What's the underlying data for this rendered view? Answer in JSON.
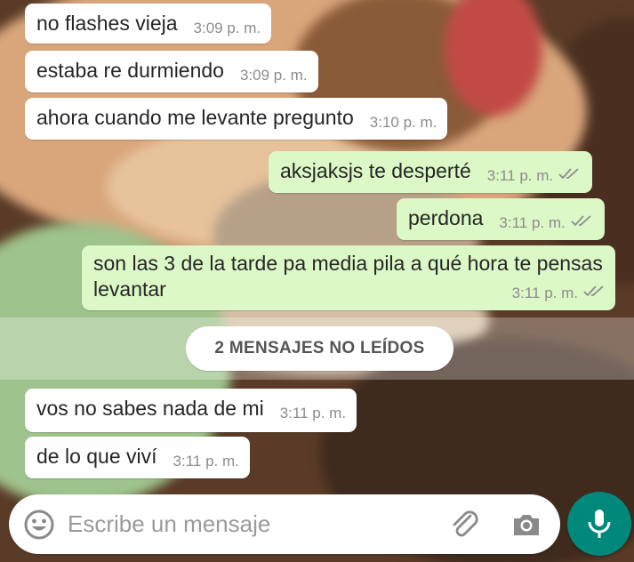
{
  "messages": [
    {
      "text": "no flashes vieja",
      "time": "3:09 p. m.",
      "direction": "in"
    },
    {
      "text": "estaba re durmiendo",
      "time": "3:09 p. m.",
      "direction": "in"
    },
    {
      "text": "ahora cuando me levante pregunto",
      "time": "3:10 p. m.",
      "direction": "in"
    },
    {
      "text": "aksjaksjs te desperté",
      "time": "3:11 p. m.",
      "direction": "out",
      "status": "read"
    },
    {
      "text": "perdona",
      "time": "3:11 p. m.",
      "direction": "out",
      "status": "read"
    },
    {
      "text": "son las 3 de la tarde pa media pila a qué hora te pensas levantar",
      "time": "3:11 p. m.",
      "direction": "out",
      "status": "read"
    },
    {
      "text": "vos no sabes nada de mi",
      "time": "3:11 p. m.",
      "direction": "in"
    },
    {
      "text": "de lo que viví",
      "time": "3:11 p. m.",
      "direction": "in"
    }
  ],
  "unread_divider": {
    "label": "2 MENSAJES NO LEÍDOS"
  },
  "composer": {
    "placeholder": "Escribe un mensaje",
    "emoji_icon": "emoji-icon",
    "attach_icon": "paperclip-icon",
    "camera_icon": "camera-icon",
    "mic_icon": "microphone-icon"
  },
  "colors": {
    "incoming_bubble": "#ffffff",
    "outgoing_bubble": "#dcf8c6",
    "accent": "#00897b",
    "read_ticks": "#8c8c8c"
  }
}
